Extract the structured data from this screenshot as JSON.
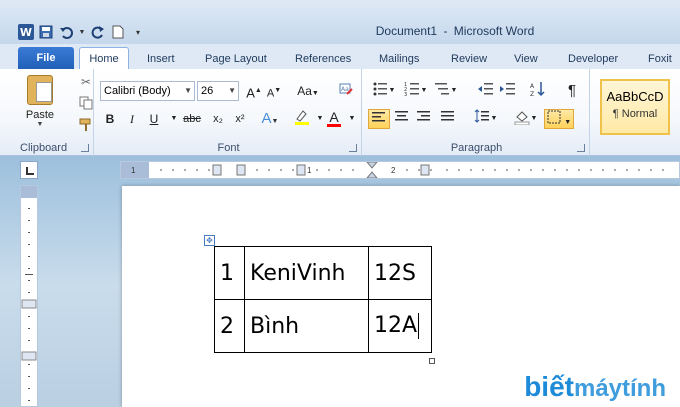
{
  "window": {
    "doc_name": "Document1",
    "separator": "-",
    "app_name": "Microsoft Word"
  },
  "qat": {
    "icons": [
      "word-logo",
      "save-icon",
      "undo-icon",
      "redo-icon",
      "new-doc-icon"
    ]
  },
  "tabs": [
    "File",
    "Home",
    "Insert",
    "Page Layout",
    "References",
    "Mailings",
    "Review",
    "View",
    "Developer",
    "Foxit R"
  ],
  "ribbon": {
    "clipboard": {
      "paste_label": "Paste",
      "group_label": "Clipboard"
    },
    "font": {
      "font_name": "Calibri (Body)",
      "font_size": "26",
      "grow": "A",
      "shrink": "A",
      "case": "Aa",
      "bold": "B",
      "italic": "I",
      "underline": "U",
      "strike": "abc",
      "subscript": "x₂",
      "superscript": "x²",
      "text_effect": "A",
      "font_color": "A",
      "group_label": "Font"
    },
    "paragraph": {
      "pilcrow": "¶",
      "group_label": "Paragraph"
    },
    "styles": {
      "sample": "AaBbCcD",
      "name": "¶ Normal"
    }
  },
  "ruler": {
    "h_ticks": [
      "1",
      "1",
      "2"
    ]
  },
  "document": {
    "table": [
      [
        "1",
        "KeniVinh",
        "12S"
      ],
      [
        "2",
        "Bình",
        "12A"
      ]
    ]
  },
  "watermark": {
    "part1": "biết",
    "part2": "máytính"
  },
  "colors": {
    "font_color_bar": "#ff0000",
    "highlight_bar": "#ffff00",
    "accent": "#2b5797"
  }
}
